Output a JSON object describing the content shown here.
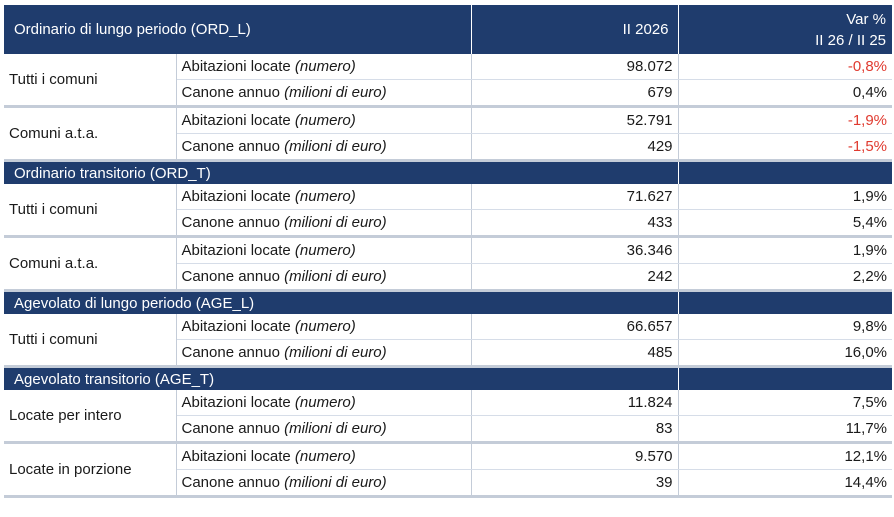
{
  "header": {
    "first_section": "Ordinario di lungo periodo (ORD_L)",
    "col_value": "II 2026",
    "col_var_line1": "Var %",
    "col_var_line2": "II 26 / II 25"
  },
  "labels": {
    "abitazioni": "Abitazioni locate ",
    "abitazioni_unit": "(numero)",
    "canone": "Canone annuo ",
    "canone_unit": "(milioni di euro)"
  },
  "sections": [
    {
      "name": "Ordinario di lungo periodo (ORD_L)",
      "groups": [
        {
          "name": "Tutti i comuni",
          "abitazioni": "98.072",
          "abitazioni_var": "-0,8%",
          "canone": "679",
          "canone_var": "0,4%"
        },
        {
          "name": "Comuni a.t.a.",
          "abitazioni": "52.791",
          "abitazioni_var": "-1,9%",
          "canone": "429",
          "canone_var": "-1,5%"
        }
      ]
    },
    {
      "name": "Ordinario transitorio (ORD_T)",
      "groups": [
        {
          "name": "Tutti i comuni",
          "abitazioni": "71.627",
          "abitazioni_var": "1,9%",
          "canone": "433",
          "canone_var": "5,4%"
        },
        {
          "name": "Comuni a.t.a.",
          "abitazioni": "36.346",
          "abitazioni_var": "1,9%",
          "canone": "242",
          "canone_var": "2,2%"
        }
      ]
    },
    {
      "name": "Agevolato di lungo periodo (AGE_L)",
      "groups": [
        {
          "name": "Tutti i comuni",
          "abitazioni": "66.657",
          "abitazioni_var": "9,8%",
          "canone": "485",
          "canone_var": "16,0%"
        }
      ]
    },
    {
      "name": "Agevolato transitorio (AGE_T)",
      "groups": [
        {
          "name": "Locate per intero",
          "abitazioni": "11.824",
          "abitazioni_var": "7,5%",
          "canone": "83",
          "canone_var": "11,7%"
        },
        {
          "name": "Locate in porzione",
          "abitazioni": "9.570",
          "abitazioni_var": "12,1%",
          "canone": "39",
          "canone_var": "14,4%"
        }
      ]
    }
  ],
  "colors": {
    "header_bg": "#1f3c6d",
    "negative": "#e03a2f"
  }
}
